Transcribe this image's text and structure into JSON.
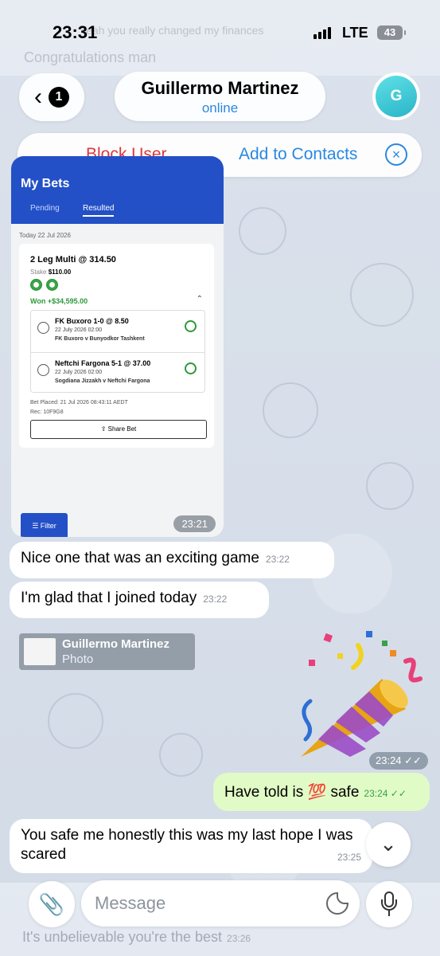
{
  "status_bar": {
    "time": "23:31",
    "network": "LTE",
    "battery": "43"
  },
  "ghost": {
    "top_line_1": "Yeah you really changed my finances",
    "top_line_2": "Congratulations man",
    "bottom_line": "It's unbelievable you're the best",
    "bottom_time": "23:26"
  },
  "header": {
    "back_count": "1",
    "contact_name": "Guillermo Martinez",
    "status": "online",
    "avatar_letter": "G"
  },
  "action_bar": {
    "block": "Block User",
    "add": "Add to Contacts"
  },
  "screenshot": {
    "title": "My Bets",
    "tabs": [
      "Pending",
      "Resulted"
    ],
    "date": "Today 22 Jul 2026",
    "bet_title": "2 Leg Multi @ 314.50",
    "stake_label": "Stake",
    "stake_value": "$110.00",
    "won": "Won  +$34,595.00",
    "legs": [
      {
        "title": "FK Buxoro 1-0  @ 8.50",
        "date": "22 July 2026 02:00",
        "match": "FK Buxoro v Bunyodkor Tashkent"
      },
      {
        "title": "Neftchi Fargona 5-1 @ 37.00",
        "date": "22 July 2026 02:00",
        "match": "Sogdiana Jizzakh v Neftchi Fargona"
      }
    ],
    "placed": "Bet Placed: 21 Jul 2026 08:43:11 AEDT",
    "rec": "Rec: 10F9G8",
    "share": "Share Bet",
    "filter": "Filter",
    "time": "23:21"
  },
  "messages": [
    {
      "text": "Nice one that was an exciting game",
      "time": "23:22"
    },
    {
      "text": "I'm glad that I joined today",
      "time": "23:22"
    }
  ],
  "reply": {
    "name": "Guillermo Martinez",
    "kind": "Photo"
  },
  "sticker_time": "23:24",
  "outgoing": {
    "text": "Have told is 💯 safe",
    "time": "23:24"
  },
  "last_message": {
    "text": "You safe me honestly this was my last hope I was scared",
    "time": "23:25"
  },
  "input": {
    "placeholder": "Message"
  }
}
